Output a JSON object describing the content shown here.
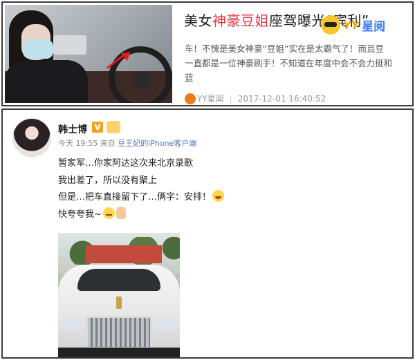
{
  "news_card": {
    "headline_prefix": "美女",
    "headline_highlight": "神豪豆姐",
    "headline_suffix": "座驾曝光“宾利”",
    "brand_text": "YY",
    "brand_text2": "星阅",
    "excerpt_lines": [
      "车！不愧是美女神豪“豆姐”实在是太霸气了！而且豆",
      "一直都是一位神豪刷手！不知道在年度中会不会力挺和",
      "蓝"
    ],
    "source_name": "YY星闻",
    "separator": "|",
    "timestamp": "2017-12-01 16:40:52"
  },
  "weibo_post": {
    "username": "韩士博",
    "verified_label": "V",
    "time": "今天 19:55",
    "from_label": "来自",
    "client": "豆王妃的iPhone客户端",
    "lines": [
      "暂家军…你家阿达这次来北京录歌",
      "我出差了，所以没有聚上",
      "但是…把车直接留下了…俩字：安排！",
      "快夸夸我~"
    ]
  },
  "icons": {
    "brand_logo": "yy-logo-icon",
    "source_logo": "yy-source-icon",
    "verified": "verified-v-icon",
    "level": "user-level-icon",
    "laugh_emoji": "laugh-emoji-icon",
    "smirk_emoji": "smirk-emoji-icon",
    "victory_hand": "victory-hand-icon"
  },
  "colors": {
    "highlight": "#e3333d",
    "client_link": "#5276b6",
    "verified_badge": "#f4a11d"
  }
}
